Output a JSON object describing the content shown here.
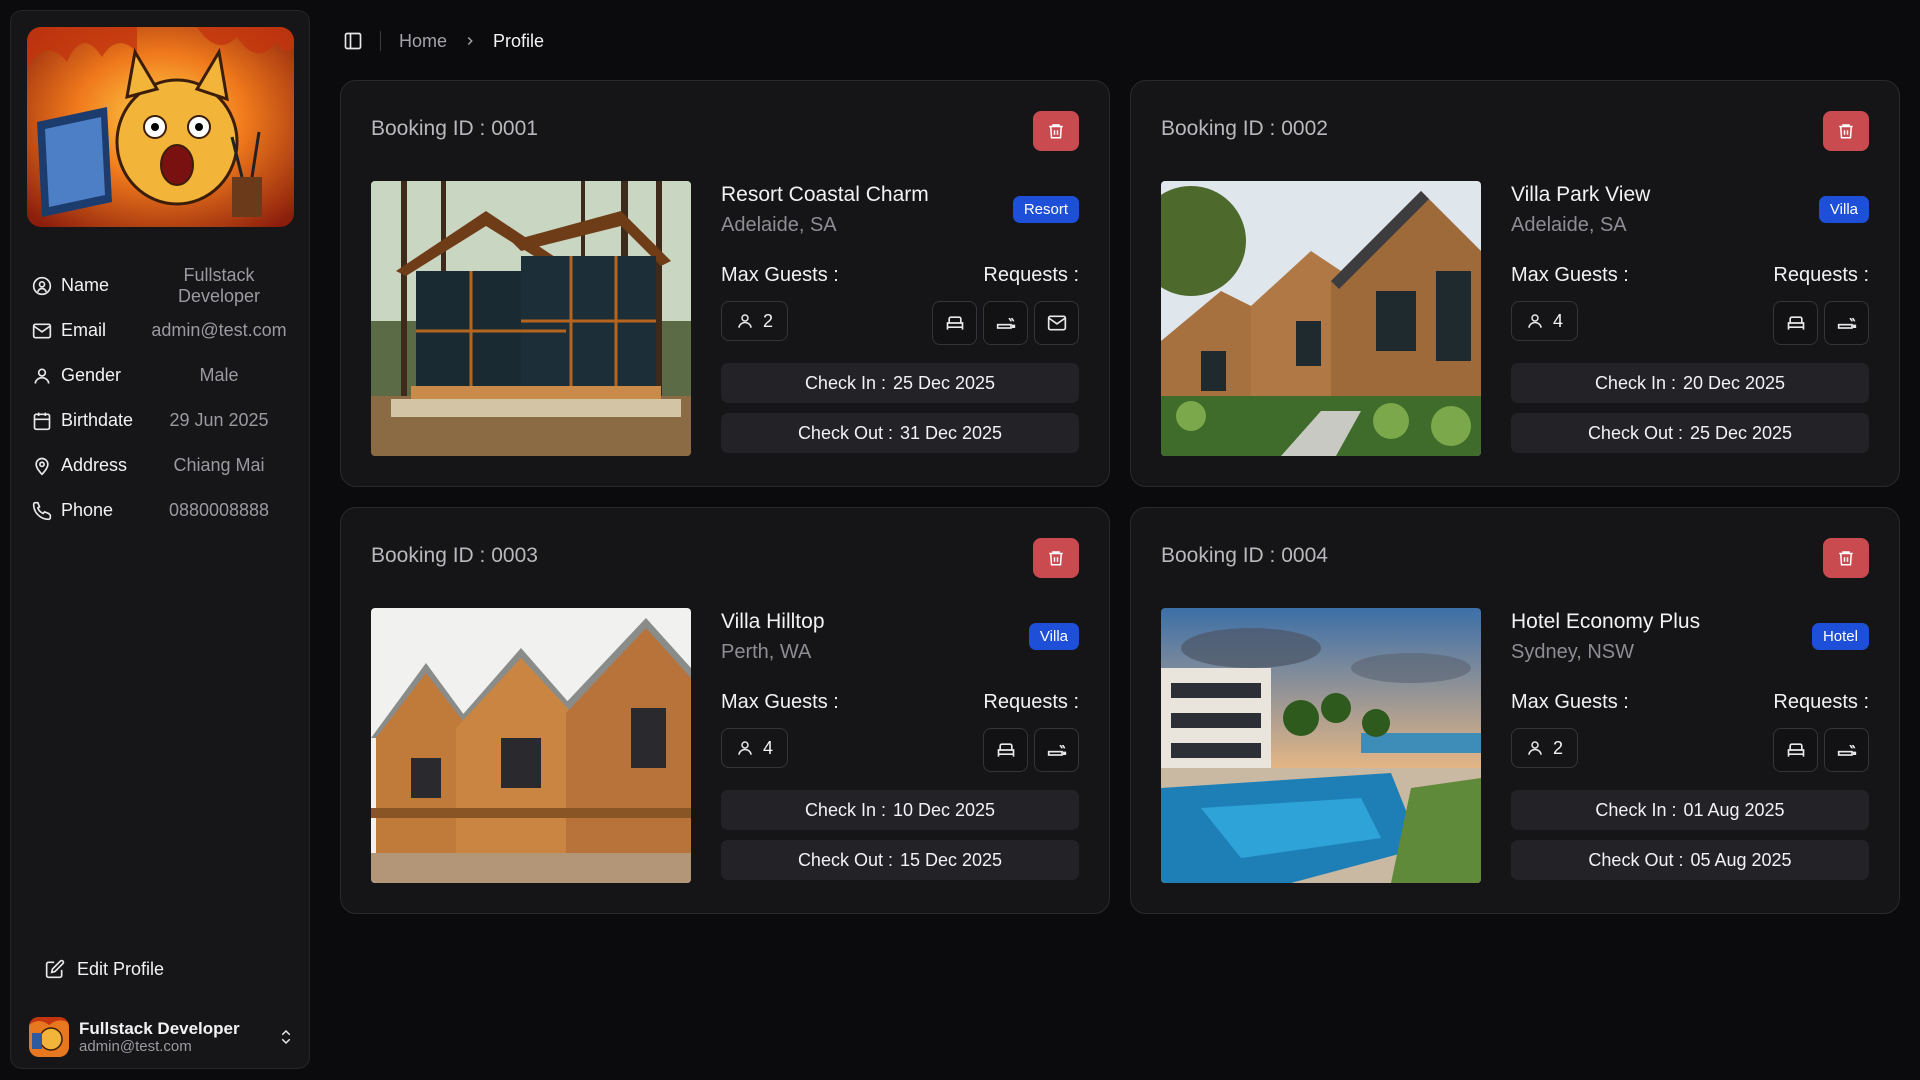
{
  "profile": {
    "fields": [
      {
        "icon": "user-circle-icon",
        "label": "Name",
        "value": "Fullstack Developer"
      },
      {
        "icon": "mail-icon",
        "label": "Email",
        "value": "admin@test.com"
      },
      {
        "icon": "user-icon",
        "label": "Gender",
        "value": "Male"
      },
      {
        "icon": "calendar-icon",
        "label": "Birthdate",
        "value": "29 Jun 2025"
      },
      {
        "icon": "map-pin-icon",
        "label": "Address",
        "value": "Chiang Mai"
      },
      {
        "icon": "phone-icon",
        "label": "Phone",
        "value": "0880008888"
      }
    ],
    "edit_label": "Edit Profile"
  },
  "user": {
    "name": "Fullstack Developer",
    "email": "admin@test.com"
  },
  "breadcrumb": {
    "home": "Home",
    "current": "Profile"
  },
  "labels": {
    "max_guests": "Max Guests :",
    "requests": "Requests :",
    "check_in": "Check In :",
    "check_out": "Check Out :"
  },
  "bookings": [
    {
      "title": "Booking ID : 0001",
      "name": "Resort Coastal Charm",
      "location": "Adelaide, SA",
      "type": "Resort",
      "guests": "2",
      "requests": [
        "bed-icon",
        "smoking-icon",
        "mail-icon"
      ],
      "check_in": "25 Dec 2025",
      "check_out": "31 Dec 2025"
    },
    {
      "title": "Booking ID : 0002",
      "name": "Villa Park View",
      "location": "Adelaide, SA",
      "type": "Villa",
      "guests": "4",
      "requests": [
        "bed-icon",
        "smoking-icon"
      ],
      "check_in": "20 Dec 2025",
      "check_out": "25 Dec 2025"
    },
    {
      "title": "Booking ID : 0003",
      "name": "Villa Hilltop",
      "location": "Perth, WA",
      "type": "Villa",
      "guests": "4",
      "requests": [
        "bed-icon",
        "smoking-icon"
      ],
      "check_in": "10 Dec 2025",
      "check_out": "15 Dec 2025"
    },
    {
      "title": "Booking ID : 0004",
      "name": "Hotel Economy Plus",
      "location": "Sydney, NSW",
      "type": "Hotel",
      "guests": "2",
      "requests": [
        "bed-icon",
        "smoking-icon"
      ],
      "check_in": "01 Aug 2025",
      "check_out": "05 Aug 2025"
    }
  ],
  "colors": {
    "accent_blue": "#1e4fd8",
    "danger": "#c94a4f",
    "background": "#0b0b0d",
    "card": "#151517"
  }
}
